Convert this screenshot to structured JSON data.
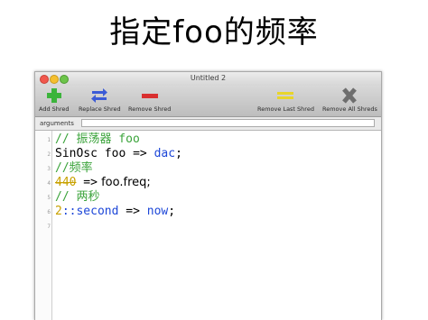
{
  "slide": {
    "title": "指定foo的频率"
  },
  "window": {
    "title": "Untitled 2",
    "toolbar": {
      "add_label": "Add Shred",
      "replace_label": "Replace Shred",
      "remove_label": "Remove Shred",
      "remove_last_label": "Remove Last Shred",
      "remove_all_label": "Remove All Shreds"
    },
    "arguments": {
      "label": "arguments",
      "value": ""
    }
  },
  "editor": {
    "line_numbers": [
      "1",
      "2",
      "3",
      "4",
      "5",
      "6",
      "7"
    ],
    "lines": {
      "l1": {
        "comment": "// 振荡器 foo"
      },
      "l2": {
        "class": "SinOsc",
        "var": " foo ",
        "op": "=>",
        "dac": " dac",
        "end": ";"
      },
      "l3": {
        "comment": "//频率"
      },
      "l4": {
        "num": "440",
        "op": " =>",
        "rest": " foo.freq;"
      },
      "l5": {
        "comment": "// 两秒"
      },
      "l6": {
        "num": "2",
        "sep": "::",
        "kw": "second",
        "op": " =>",
        "now": " now",
        "end": ";"
      }
    }
  },
  "colors": {
    "comment": "#3aa33a",
    "keyword": "#1d47d8",
    "number": "#c8a100",
    "add_icon": "#3cb43c",
    "replace_icon": "#3b5bd6",
    "remove_icon": "#d93030",
    "remove_last_icon": "#e8d52a",
    "remove_all_icon": "#6e6e6e"
  },
  "icons": {
    "add": "plus-icon",
    "replace": "swap-arrows-icon",
    "remove": "minus-icon",
    "remove_last": "double-bar-icon",
    "remove_all": "x-icon"
  }
}
